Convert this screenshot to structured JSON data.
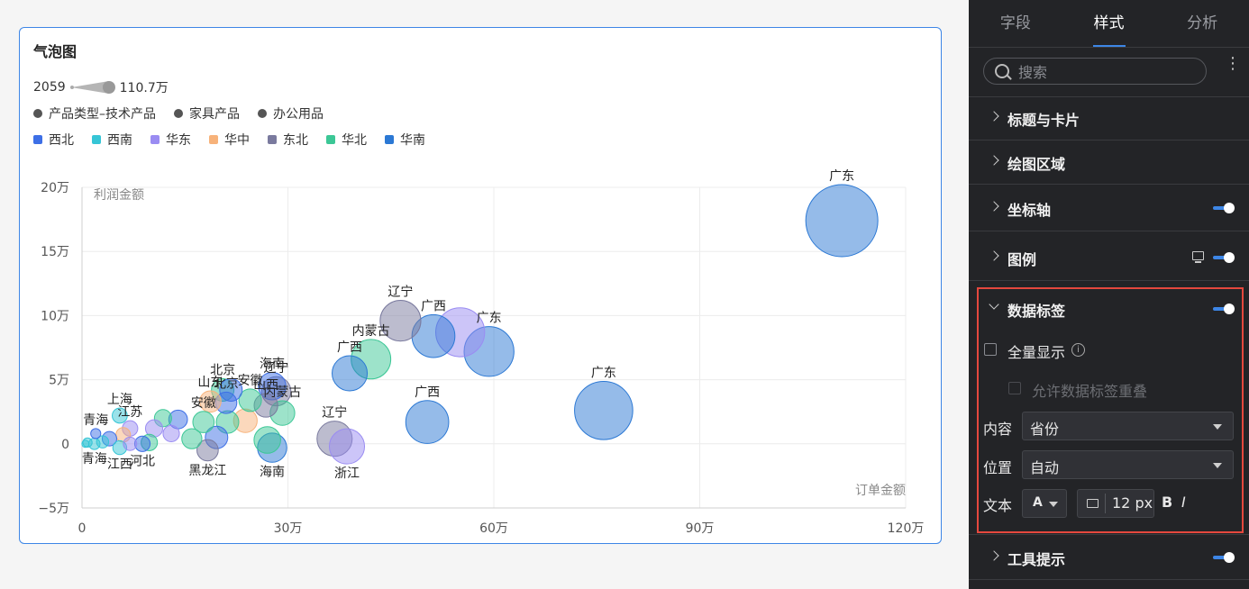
{
  "card": {
    "title": "气泡图",
    "size_legend": {
      "min": "2059",
      "max": "110.7万"
    },
    "shape_legend": [
      "产品类型–技术产品",
      "家具产品",
      "办公用品"
    ],
    "region_legend": [
      {
        "name": "西北",
        "color": "#3d6fe6"
      },
      {
        "name": "西南",
        "color": "#36c5d6"
      },
      {
        "name": "华东",
        "color": "#9a8cf2"
      },
      {
        "name": "华中",
        "color": "#f7b27a"
      },
      {
        "name": "东北",
        "color": "#7a7a9e"
      },
      {
        "name": "华北",
        "color": "#3cc796"
      },
      {
        "name": "华南",
        "color": "#2b78d4"
      }
    ]
  },
  "chart_data": {
    "type": "scatter",
    "xlabel": "订单金额",
    "ylabel": "利润金额",
    "xlim": [
      0,
      1200000
    ],
    "ylim": [
      -50000,
      200000
    ],
    "xticks": [
      {
        "value": 0,
        "label": "0"
      },
      {
        "value": 300000,
        "label": "30万"
      },
      {
        "value": 600000,
        "label": "60万"
      },
      {
        "value": 900000,
        "label": "90万"
      },
      {
        "value": 1200000,
        "label": "120万"
      }
    ],
    "yticks": [
      {
        "value": -50000,
        "label": "−5万"
      },
      {
        "value": 0,
        "label": "0"
      },
      {
        "value": 50000,
        "label": "5万"
      },
      {
        "value": 100000,
        "label": "10万"
      },
      {
        "value": 150000,
        "label": "15万"
      },
      {
        "value": 200000,
        "label": "20万"
      }
    ],
    "size_range": [
      2059,
      1107000
    ],
    "points": [
      {
        "x": 1107000,
        "y": 174000,
        "size": 1107000,
        "region": "华南",
        "label": "广东",
        "label_pos": "top"
      },
      {
        "x": 760000,
        "y": 26000,
        "size": 700000,
        "region": "华南",
        "label": "广东",
        "label_pos": "top"
      },
      {
        "x": 593000,
        "y": 72000,
        "size": 500000,
        "region": "华南",
        "label": "广东",
        "label_pos": "top"
      },
      {
        "x": 551000,
        "y": 87000,
        "size": 480000,
        "region": "华东",
        "label": "",
        "label_pos": "top"
      },
      {
        "x": 512000,
        "y": 84000,
        "size": 360000,
        "region": "华南",
        "label": "广西",
        "label_pos": "top"
      },
      {
        "x": 464000,
        "y": 96000,
        "size": 320000,
        "region": "东北",
        "label": "辽宁",
        "label_pos": "top"
      },
      {
        "x": 421000,
        "y": 66000,
        "size": 300000,
        "region": "华北",
        "label": "内蒙古",
        "label_pos": "top"
      },
      {
        "x": 390000,
        "y": 55000,
        "size": 230000,
        "region": "华南",
        "label": "广西",
        "label_pos": "top"
      },
      {
        "x": 503000,
        "y": 17000,
        "size": 360000,
        "region": "华南",
        "label": "广西",
        "label_pos": "top"
      },
      {
        "x": 368000,
        "y": 4000,
        "size": 230000,
        "region": "东北",
        "label": "辽宁",
        "label_pos": "top"
      },
      {
        "x": 386000,
        "y": -2000,
        "size": 230000,
        "region": "华东",
        "label": "浙江",
        "label_pos": "bottom"
      },
      {
        "x": 283000,
        "y": 41000,
        "size": 150000,
        "region": "东北",
        "label": "辽宁",
        "label_pos": "top"
      },
      {
        "x": 277000,
        "y": 45000,
        "size": 130000,
        "region": "西北",
        "label": "海南",
        "label_pos": "top"
      },
      {
        "x": 292000,
        "y": 24000,
        "size": 100000,
        "region": "华北",
        "label": "内蒙古",
        "label_pos": "top"
      },
      {
        "x": 270000,
        "y": 3000,
        "size": 120000,
        "region": "华北",
        "label": "",
        "label_pos": "top"
      },
      {
        "x": 277000,
        "y": -3000,
        "size": 150000,
        "region": "华南",
        "label": "海南",
        "label_pos": "bottom"
      },
      {
        "x": 268000,
        "y": 30000,
        "size": 90000,
        "region": "东北",
        "label": "山西",
        "label_pos": "top"
      },
      {
        "x": 245000,
        "y": 34000,
        "size": 80000,
        "region": "华北",
        "label": "安徽",
        "label_pos": "top"
      },
      {
        "x": 205000,
        "y": 42000,
        "size": 80000,
        "region": "华北",
        "label": "北京",
        "label_pos": "top"
      },
      {
        "x": 217000,
        "y": 42000,
        "size": 80000,
        "region": "西北",
        "label": "",
        "label_pos": "top"
      },
      {
        "x": 210000,
        "y": 32000,
        "size": 70000,
        "region": "西北",
        "label": "北京",
        "label_pos": "top"
      },
      {
        "x": 187000,
        "y": 33000,
        "size": 70000,
        "region": "华中",
        "label": "山东",
        "label_pos": "top"
      },
      {
        "x": 177000,
        "y": 17000,
        "size": 70000,
        "region": "华北",
        "label": "安徽",
        "label_pos": "top"
      },
      {
        "x": 238000,
        "y": 18000,
        "size": 90000,
        "region": "华中",
        "label": "",
        "label_pos": "top"
      },
      {
        "x": 212000,
        "y": 17000,
        "size": 80000,
        "region": "华北",
        "label": "",
        "label_pos": "top"
      },
      {
        "x": 196000,
        "y": 5000,
        "size": 80000,
        "region": "西北",
        "label": "",
        "label_pos": "top"
      },
      {
        "x": 183000,
        "y": -5000,
        "size": 70000,
        "region": "东北",
        "label": "黑龙江",
        "label_pos": "bottom"
      },
      {
        "x": 160000,
        "y": 4000,
        "size": 60000,
        "region": "华北",
        "label": "",
        "label_pos": "top"
      },
      {
        "x": 140000,
        "y": 19000,
        "size": 50000,
        "region": "西北",
        "label": "",
        "label_pos": "top"
      },
      {
        "x": 118000,
        "y": 20000,
        "size": 40000,
        "region": "华北",
        "label": "",
        "label_pos": "top"
      },
      {
        "x": 105000,
        "y": 12000,
        "size": 40000,
        "region": "华东",
        "label": "",
        "label_pos": "top"
      },
      {
        "x": 98000,
        "y": 1000,
        "size": 35000,
        "region": "华北",
        "label": "",
        "label_pos": "top"
      },
      {
        "x": 88000,
        "y": 0,
        "size": 30000,
        "region": "西北",
        "label": "河北",
        "label_pos": "bottom"
      },
      {
        "x": 70000,
        "y": 12000,
        "size": 30000,
        "region": "华东",
        "label": "江苏",
        "label_pos": "top"
      },
      {
        "x": 55000,
        "y": 22000,
        "size": 28000,
        "region": "西南",
        "label": "上海",
        "label_pos": "top"
      },
      {
        "x": 60000,
        "y": 7000,
        "size": 25000,
        "region": "华中",
        "label": "",
        "label_pos": "top"
      },
      {
        "x": 55000,
        "y": -3000,
        "size": 22000,
        "region": "西南",
        "label": "江西",
        "label_pos": "bottom"
      },
      {
        "x": 40000,
        "y": 4000,
        "size": 25000,
        "region": "西北",
        "label": "",
        "label_pos": "top"
      },
      {
        "x": 20000,
        "y": 8000,
        "size": 8000,
        "region": "西北",
        "label": "青海",
        "label_pos": "top"
      },
      {
        "x": 18000,
        "y": 0,
        "size": 12000,
        "region": "西南",
        "label": "青海",
        "label_pos": "bottom"
      },
      {
        "x": 8000,
        "y": 1000,
        "size": 6000,
        "region": "西南",
        "label": "",
        "label_pos": "top"
      },
      {
        "x": 30000,
        "y": 1500,
        "size": 15000,
        "region": "西南",
        "label": "",
        "label_pos": "top"
      },
      {
        "x": 5000,
        "y": 0,
        "size": 2059,
        "region": "西南",
        "label": "",
        "label_pos": "top"
      },
      {
        "x": 130000,
        "y": 8000,
        "size": 35000,
        "region": "华东",
        "label": "",
        "label_pos": "top"
      },
      {
        "x": 70000,
        "y": 0,
        "size": 20000,
        "region": "华东",
        "label": "",
        "label_pos": "top"
      }
    ]
  },
  "panel": {
    "tabs": [
      "字段",
      "样式",
      "分析"
    ],
    "active_tab": 1,
    "search_placeholder": "搜索",
    "sections": {
      "title_card": "标题与卡片",
      "plot_area": "绘图区域",
      "axis": "坐标轴",
      "legend": "图例",
      "data_label": "数据标签",
      "tooltip": "工具提示"
    },
    "data_label": {
      "show_all": "全量显示",
      "allow_overlap": "允许数据标签重叠",
      "content_label": "内容",
      "content_value": "省份",
      "position_label": "位置",
      "position_value": "自动",
      "text_label": "文本",
      "font_letter": "A",
      "font_size": "12 px",
      "bold": "B",
      "italic": "I"
    }
  }
}
